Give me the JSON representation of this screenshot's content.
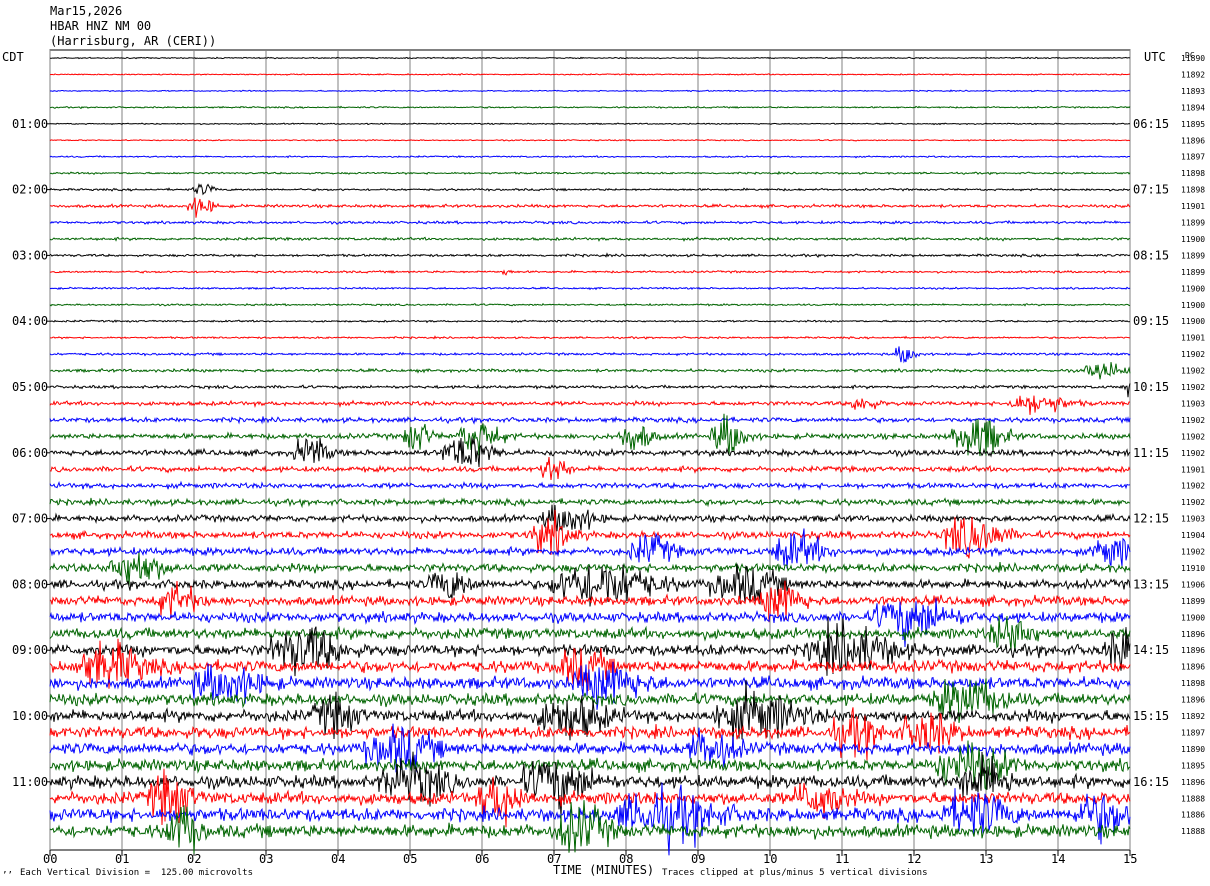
{
  "header": {
    "date": "Mar15,2026",
    "station": "HBAR HNZ NM 00",
    "location": "(Harrisburg, AR (CERI))"
  },
  "left_timezone": "CDT",
  "right_timezone": "UTC",
  "dc_label": "DC",
  "footer": {
    "scale_note": "Each Vertical Division =  125.00 microvolts",
    "clip_note": "Traces clipped at plus/minus 5 vertical divisions",
    "corner_mark": "’’"
  },
  "chart_data": {
    "type": "line",
    "title": "HBAR HNZ NM 00",
    "xlabel": "TIME (MINUTES)",
    "ylabel": "",
    "xlim": [
      0,
      15
    ],
    "x_ticks": [
      "00",
      "01",
      "02",
      "03",
      "04",
      "05",
      "06",
      "07",
      "08",
      "09",
      "10",
      "11",
      "12",
      "13",
      "14",
      "15"
    ],
    "trace_colors": [
      "#000000",
      "#ff0000",
      "#0000ff",
      "#006400"
    ],
    "grid": true,
    "left_labels": [
      {
        "trace": 4,
        "text": "01:00"
      },
      {
        "trace": 8,
        "text": "02:00"
      },
      {
        "trace": 12,
        "text": "03:00"
      },
      {
        "trace": 16,
        "text": "04:00"
      },
      {
        "trace": 20,
        "text": "05:00"
      },
      {
        "trace": 24,
        "text": "06:00"
      },
      {
        "trace": 28,
        "text": "07:00"
      },
      {
        "trace": 32,
        "text": "08:00"
      },
      {
        "trace": 36,
        "text": "09:00"
      },
      {
        "trace": 40,
        "text": "10:00"
      },
      {
        "trace": 44,
        "text": "11:00"
      }
    ],
    "right_labels": [
      {
        "trace": 4,
        "text": "06:15"
      },
      {
        "trace": 8,
        "text": "07:15"
      },
      {
        "trace": 12,
        "text": "08:15"
      },
      {
        "trace": 16,
        "text": "09:15"
      },
      {
        "trace": 20,
        "text": "10:15"
      },
      {
        "trace": 24,
        "text": "11:15"
      },
      {
        "trace": 28,
        "text": "12:15"
      },
      {
        "trace": 32,
        "text": "13:15"
      },
      {
        "trace": 36,
        "text": "14:15"
      },
      {
        "trace": 40,
        "text": "15:15"
      },
      {
        "trace": 44,
        "text": "16:15"
      }
    ],
    "dc_offsets": [
      "11890",
      "11892",
      "11893",
      "11894",
      "11895",
      "11896",
      "11897",
      "11898",
      "11898",
      "11901",
      "11899",
      "11900",
      "11899",
      "11899",
      "11900",
      "11900",
      "11900",
      "11901",
      "11902",
      "11902",
      "11902",
      "11903",
      "11902",
      "11902",
      "11902",
      "11901",
      "11902",
      "11902",
      "11903",
      "11904",
      "11902",
      "11910",
      "11906",
      "11899",
      "11900",
      "11896",
      "11896",
      "11896",
      "11898",
      "11896",
      "11892",
      "11897",
      "11890",
      "11895",
      "11896",
      "11888",
      "11886",
      "11888"
    ],
    "trace_noise_levels": [
      0.4,
      0.4,
      0.4,
      0.5,
      0.4,
      0.4,
      0.5,
      0.6,
      0.7,
      1.0,
      0.9,
      0.9,
      0.8,
      0.7,
      0.6,
      0.6,
      0.6,
      0.6,
      0.8,
      1.0,
      1.0,
      1.4,
      1.6,
      1.8,
      2.0,
      1.8,
      1.8,
      2.0,
      2.2,
      2.4,
      2.6,
      2.8,
      3.0,
      3.2,
      3.4,
      3.6,
      3.8,
      4.0,
      4.0,
      4.0,
      4.0,
      4.0,
      4.0,
      4.0,
      4.2,
      4.2,
      4.4,
      4.4
    ],
    "bursts": [
      {
        "trace": 8,
        "minute": 2.05,
        "amp": 4,
        "dur": 0.25
      },
      {
        "trace": 9,
        "minute": 2.0,
        "amp": 7,
        "dur": 0.3
      },
      {
        "trace": 13,
        "minute": 6.3,
        "amp": 3,
        "dur": 0.1
      },
      {
        "trace": 18,
        "minute": 11.8,
        "amp": 7,
        "dur": 0.25
      },
      {
        "trace": 19,
        "minute": 14.5,
        "amp": 6,
        "dur": 0.5
      },
      {
        "trace": 20,
        "minute": 14.95,
        "amp": 8,
        "dur": 0.15
      },
      {
        "trace": 21,
        "minute": 11.2,
        "amp": 6,
        "dur": 0.3
      },
      {
        "trace": 21,
        "minute": 13.5,
        "amp": 7,
        "dur": 0.7
      },
      {
        "trace": 23,
        "minute": 5.0,
        "amp": 12,
        "dur": 0.3
      },
      {
        "trace": 23,
        "minute": 5.8,
        "amp": 12,
        "dur": 0.5
      },
      {
        "trace": 23,
        "minute": 8.0,
        "amp": 10,
        "dur": 0.4
      },
      {
        "trace": 23,
        "minute": 9.3,
        "amp": 14,
        "dur": 0.4
      },
      {
        "trace": 23,
        "minute": 12.7,
        "amp": 15,
        "dur": 0.6
      },
      {
        "trace": 24,
        "minute": 3.5,
        "amp": 10,
        "dur": 0.4
      },
      {
        "trace": 24,
        "minute": 5.6,
        "amp": 12,
        "dur": 0.6
      },
      {
        "trace": 25,
        "minute": 6.9,
        "amp": 10,
        "dur": 0.3
      },
      {
        "trace": 28,
        "minute": 7.0,
        "amp": 10,
        "dur": 0.6
      },
      {
        "trace": 29,
        "minute": 6.8,
        "amp": 12,
        "dur": 0.5
      },
      {
        "trace": 29,
        "minute": 12.6,
        "amp": 14,
        "dur": 0.7
      },
      {
        "trace": 30,
        "minute": 8.2,
        "amp": 10,
        "dur": 0.5
      },
      {
        "trace": 30,
        "minute": 10.2,
        "amp": 12,
        "dur": 0.6
      },
      {
        "trace": 30,
        "minute": 14.6,
        "amp": 10,
        "dur": 0.5
      },
      {
        "trace": 31,
        "minute": 1.0,
        "amp": 12,
        "dur": 0.6
      },
      {
        "trace": 32,
        "minute": 5.4,
        "amp": 10,
        "dur": 0.5
      },
      {
        "trace": 32,
        "minute": 7.3,
        "amp": 16,
        "dur": 1.2
      },
      {
        "trace": 32,
        "minute": 9.4,
        "amp": 12,
        "dur": 0.8
      },
      {
        "trace": 33,
        "minute": 1.6,
        "amp": 10,
        "dur": 0.5
      },
      {
        "trace": 33,
        "minute": 10.0,
        "amp": 14,
        "dur": 0.5
      },
      {
        "trace": 34,
        "minute": 11.7,
        "amp": 14,
        "dur": 0.9
      },
      {
        "trace": 35,
        "minute": 13.2,
        "amp": 12,
        "dur": 0.5
      },
      {
        "trace": 36,
        "minute": 3.3,
        "amp": 16,
        "dur": 0.8
      },
      {
        "trace": 36,
        "minute": 10.8,
        "amp": 16,
        "dur": 1.0
      },
      {
        "trace": 36,
        "minute": 14.8,
        "amp": 14,
        "dur": 0.5
      },
      {
        "trace": 37,
        "minute": 0.6,
        "amp": 14,
        "dur": 0.8
      },
      {
        "trace": 37,
        "minute": 7.2,
        "amp": 12,
        "dur": 0.6
      },
      {
        "trace": 38,
        "minute": 2.2,
        "amp": 12,
        "dur": 0.8
      },
      {
        "trace": 38,
        "minute": 7.5,
        "amp": 14,
        "dur": 0.8
      },
      {
        "trace": 39,
        "minute": 12.5,
        "amp": 14,
        "dur": 0.8
      },
      {
        "trace": 40,
        "minute": 3.8,
        "amp": 12,
        "dur": 0.5
      },
      {
        "trace": 40,
        "minute": 7.0,
        "amp": 14,
        "dur": 0.8
      },
      {
        "trace": 40,
        "minute": 9.5,
        "amp": 16,
        "dur": 1.0
      },
      {
        "trace": 41,
        "minute": 11.0,
        "amp": 12,
        "dur": 0.6
      },
      {
        "trace": 41,
        "minute": 12.0,
        "amp": 14,
        "dur": 0.6
      },
      {
        "trace": 42,
        "minute": 4.6,
        "amp": 14,
        "dur": 0.8
      },
      {
        "trace": 42,
        "minute": 9.0,
        "amp": 12,
        "dur": 0.6
      },
      {
        "trace": 43,
        "minute": 12.5,
        "amp": 14,
        "dur": 0.9
      },
      {
        "trace": 44,
        "minute": 4.8,
        "amp": 14,
        "dur": 0.8
      },
      {
        "trace": 44,
        "minute": 6.8,
        "amp": 16,
        "dur": 0.8
      },
      {
        "trace": 44,
        "minute": 12.8,
        "amp": 14,
        "dur": 0.6
      },
      {
        "trace": 45,
        "minute": 1.5,
        "amp": 16,
        "dur": 0.5
      },
      {
        "trace": 45,
        "minute": 6.1,
        "amp": 16,
        "dur": 0.5
      },
      {
        "trace": 45,
        "minute": 10.5,
        "amp": 12,
        "dur": 0.6
      },
      {
        "trace": 46,
        "minute": 8.2,
        "amp": 16,
        "dur": 1.2
      },
      {
        "trace": 46,
        "minute": 12.6,
        "amp": 14,
        "dur": 0.8
      },
      {
        "trace": 46,
        "minute": 14.4,
        "amp": 14,
        "dur": 0.6
      },
      {
        "trace": 47,
        "minute": 1.7,
        "amp": 16,
        "dur": 0.4
      },
      {
        "trace": 47,
        "minute": 7.2,
        "amp": 16,
        "dur": 0.6
      }
    ]
  }
}
